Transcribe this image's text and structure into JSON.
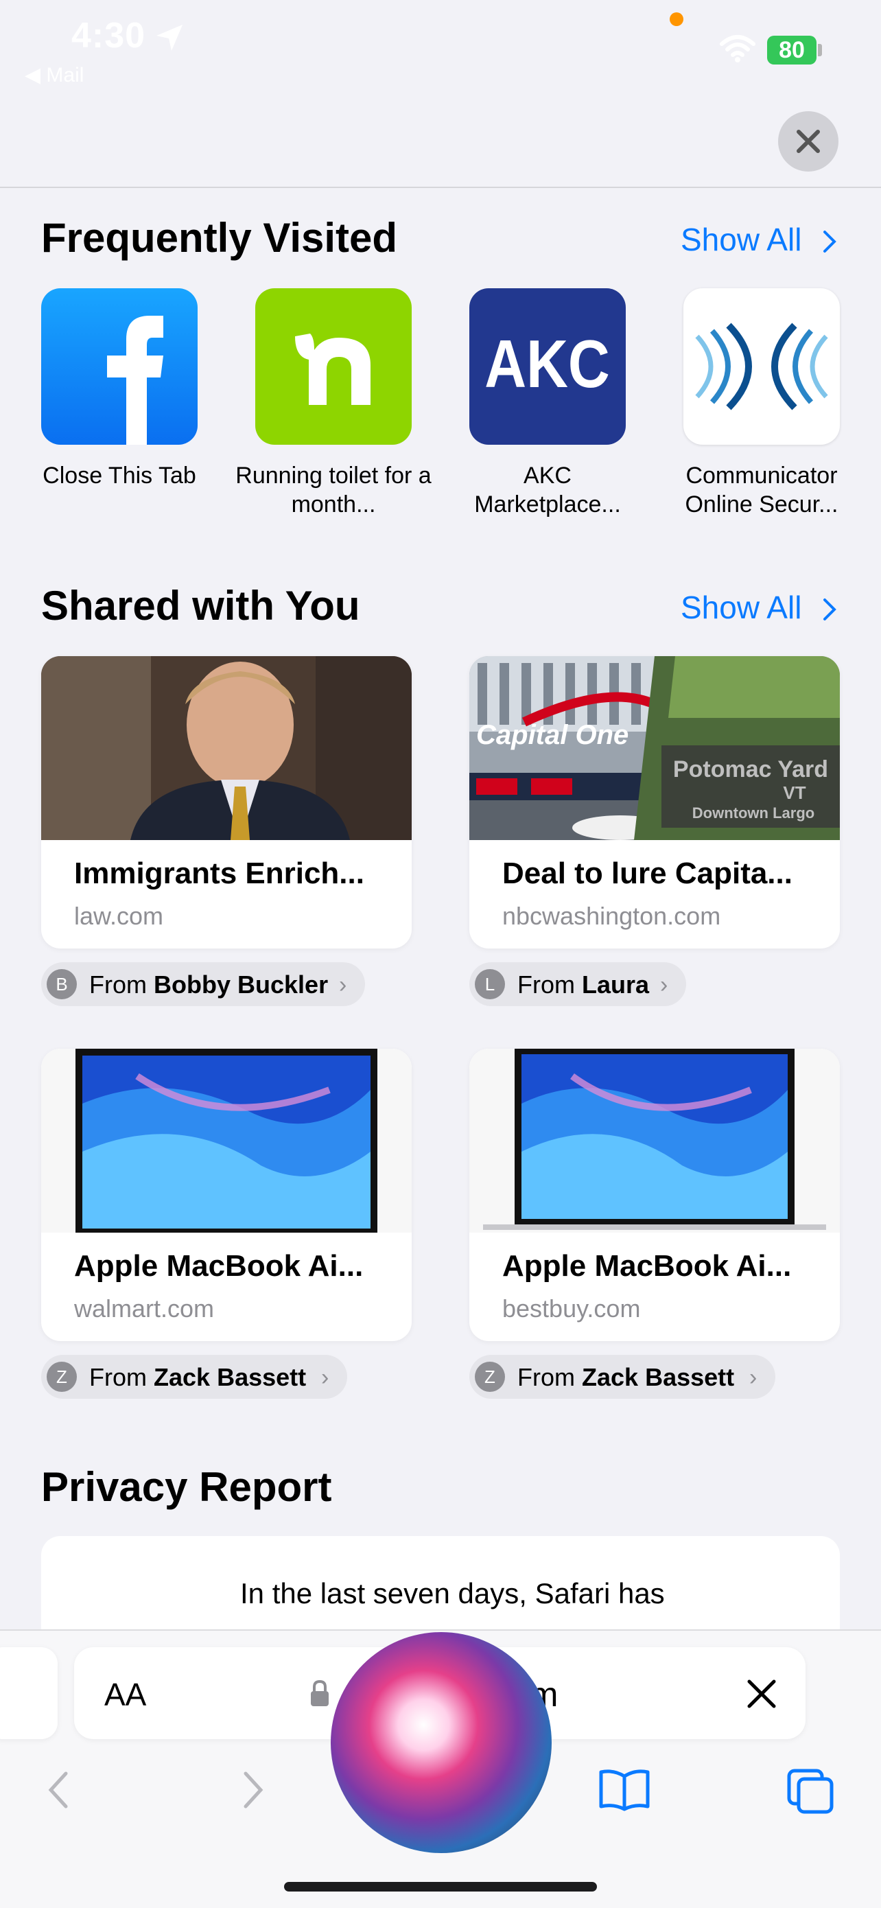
{
  "status_bar": {
    "time": "4:30",
    "back_app": "◀ Mail",
    "battery": "80"
  },
  "frequently_visited": {
    "title": "Frequently Visited",
    "show_all": "Show All",
    "items": [
      {
        "label": "Close This Tab",
        "icon": "facebook-icon",
        "color": "#1877f2"
      },
      {
        "label": "Running toilet for a month...",
        "icon": "nextdoor-icon",
        "color": "#8ed500"
      },
      {
        "label": "AKC Marketplace...",
        "icon": "akc-icon",
        "color": "#1e3a8a"
      },
      {
        "label": "Communicator Online Secur...",
        "icon": "communicator-icon",
        "color": "#ffffff"
      }
    ]
  },
  "shared_with_you": {
    "title": "Shared with You",
    "show_all": "Show All",
    "cards": [
      {
        "title": "Immigrants Enrich...",
        "domain": "law.com",
        "from_label": "From",
        "from_name": "Bobby Buckler",
        "initial": "B"
      },
      {
        "title": "Deal to lure Capita...",
        "domain": "nbcwashington.com",
        "from_label": "From",
        "from_name": "Laura",
        "initial": "L"
      },
      {
        "title": "Apple MacBook Ai...",
        "domain": "walmart.com",
        "from_label": "From",
        "from_name": "Zack Bassett",
        "initial": "Z"
      },
      {
        "title": "Apple MacBook Ai...",
        "domain": "bestbuy.com",
        "from_label": "From",
        "from_name": "Zack Bassett",
        "initial": "Z"
      }
    ],
    "thumb_text": {
      "capital_one": "Capital One",
      "station_line1": "Potomac Yard",
      "station_line2": "VT",
      "station_line3": "Downtown Largo"
    }
  },
  "privacy_report": {
    "title": "Privacy Report",
    "text": "In the last seven days, Safari has"
  },
  "address_bar": {
    "aa": "AA",
    "url_fragment": "om"
  },
  "colors": {
    "accent": "#0a7aff",
    "background": "#f2f2f7"
  }
}
